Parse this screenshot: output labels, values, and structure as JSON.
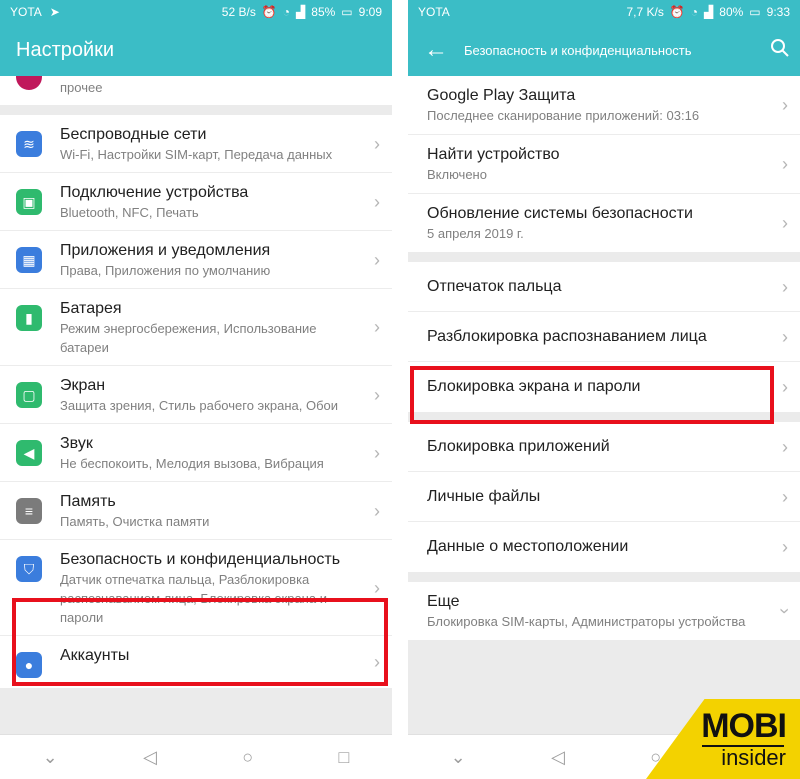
{
  "left": {
    "status": {
      "carrier": "YOTA",
      "speed": "52 B/s",
      "battery": "85%",
      "time": "9:09"
    },
    "title": "Настройки",
    "partial_item": {
      "subtitle": "прочее"
    },
    "items": [
      {
        "title": "Беспроводные сети",
        "subtitle": "Wi-Fi, Настройки SIM-карт, Передача данных",
        "icon": "wifi-icon",
        "color": "#3b7ddd"
      },
      {
        "title": "Подключение устройства",
        "subtitle": "Bluetooth, NFC, Печать",
        "icon": "device-connection-icon",
        "color": "#2fba6e"
      },
      {
        "title": "Приложения и уведомления",
        "subtitle": "Права, Приложения по умолчанию",
        "icon": "apps-icon",
        "color": "#3b7ddd"
      },
      {
        "title": "Батарея",
        "subtitle": "Режим энергосбережения, Использование батареи",
        "icon": "battery-icon",
        "color": "#2fba6e"
      },
      {
        "title": "Экран",
        "subtitle": "Защита зрения, Стиль рабочего экрана, Обои",
        "icon": "display-icon",
        "color": "#2fba6e"
      },
      {
        "title": "Звук",
        "subtitle": "Не беспокоить, Мелодия вызова, Вибрация",
        "icon": "sound-icon",
        "color": "#2fba6e"
      },
      {
        "title": "Память",
        "subtitle": "Память, Очистка памяти",
        "icon": "storage-icon",
        "color": "#7b7b7b"
      },
      {
        "title": "Безопасность и конфиденциальность",
        "subtitle": "Датчик отпечатка пальца, Разблокировка распознаванием лица, Блокировка экрана и пароли",
        "icon": "security-shield-icon",
        "color": "#3b7ddd"
      },
      {
        "title": "Аккаунты",
        "subtitle": "",
        "icon": "account-icon",
        "color": "#3b7ddd"
      }
    ]
  },
  "right": {
    "status": {
      "carrier": "YOTA",
      "speed": "7,7 K/s",
      "battery": "80%",
      "time": "9:33"
    },
    "title": "Безопасность и конфиденциальность",
    "groups": [
      [
        {
          "title": "Google Play Защита",
          "subtitle": "Последнее сканирование приложений: 03:16"
        },
        {
          "title": "Найти устройство",
          "subtitle": "Включено"
        },
        {
          "title": "Обновление системы безопасности",
          "subtitle": "5 апреля 2019 г."
        }
      ],
      [
        {
          "title": "Отпечаток пальца",
          "subtitle": ""
        },
        {
          "title": "Разблокировка распознаванием лица",
          "subtitle": ""
        },
        {
          "title": "Блокировка экрана и пароли",
          "subtitle": ""
        }
      ],
      [
        {
          "title": "Блокировка приложений",
          "subtitle": ""
        },
        {
          "title": "Личные файлы",
          "subtitle": ""
        },
        {
          "title": "Данные о местоположении",
          "subtitle": ""
        }
      ],
      [
        {
          "title": "Еще",
          "subtitle": "Блокировка SIM-карты, Администраторы устройства",
          "expand": true
        }
      ]
    ]
  },
  "watermark": {
    "line1": "MOBI",
    "line2": "insider",
    "color": "#f3d200"
  },
  "highlight_color": "#e8101c"
}
